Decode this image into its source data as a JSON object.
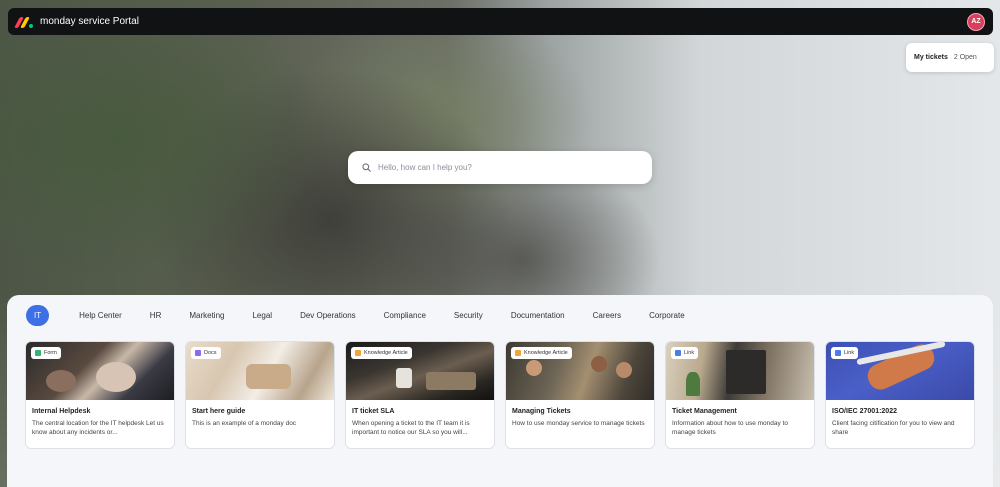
{
  "app": {
    "title": "monday service Portal",
    "avatar_initials": "AZ",
    "avatar_color": "#d6405c"
  },
  "my_tickets": {
    "label": "My tickets",
    "count": "2 Open"
  },
  "search": {
    "placeholder": "Hello, how can I help you?",
    "value": ""
  },
  "tabs": [
    {
      "label": "IT",
      "active": true
    },
    {
      "label": "Help Center",
      "active": false
    },
    {
      "label": "HR",
      "active": false
    },
    {
      "label": "Marketing",
      "active": false
    },
    {
      "label": "Legal",
      "active": false
    },
    {
      "label": "Dev Operations",
      "active": false
    },
    {
      "label": "Compliance",
      "active": false
    },
    {
      "label": "Security",
      "active": false
    },
    {
      "label": "Documentation",
      "active": false
    },
    {
      "label": "Careers",
      "active": false
    },
    {
      "label": "Corporate",
      "active": false
    }
  ],
  "cards": [
    {
      "badge": "Form",
      "badge_icon": "form-icon",
      "badge_color": "#33b56f",
      "title": "Internal Helpdesk",
      "description": "The central location for the IT helpdesk Let us know about any incidents or..."
    },
    {
      "badge": "Docs",
      "badge_icon": "docs-icon",
      "badge_color": "#8b6cf0",
      "title": "Start here guide",
      "description": "This is an example of a monday doc"
    },
    {
      "badge": "Knowledge Article",
      "badge_icon": "knowledge-article-icon",
      "badge_color": "#f2a33a",
      "title": "IT ticket SLA",
      "description": "When opening a ticket to the IT team it is important to notice our SLA so you will..."
    },
    {
      "badge": "Knowledge Article",
      "badge_icon": "knowledge-article-icon",
      "badge_color": "#f2a33a",
      "title": "Managing Tickets",
      "description": "How to use monday service to manage tickets"
    },
    {
      "badge": "Link",
      "badge_icon": "link-icon",
      "badge_color": "#4a7de8",
      "title": "Ticket Management",
      "description": "Information about how to use monday to manage tickets"
    },
    {
      "badge": "Link",
      "badge_icon": "link-icon",
      "badge_color": "#4a7de8",
      "title": "ISO/IEC 27001:2022",
      "description": "Client facing citification for you to view and share"
    }
  ],
  "colors": {
    "accent": "#3d70e6",
    "topbar": "#111214"
  }
}
